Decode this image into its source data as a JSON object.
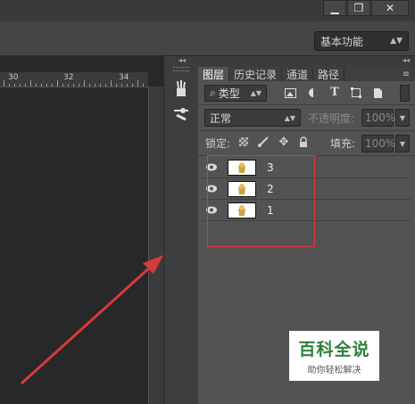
{
  "window": {
    "minimize_label": "▁",
    "restore_label": "❐",
    "close_label": "✕"
  },
  "options_bar": {
    "workspace": "基本功能"
  },
  "ruler": {
    "labels": [
      "30",
      "32",
      "34"
    ]
  },
  "layers_panel": {
    "tabs": [
      "图层",
      "历史记录",
      "通道",
      "路径"
    ],
    "filter_kind": "类型",
    "blend_mode": "正常",
    "opacity_label": "不透明度:",
    "opacity_value": "100%",
    "lock_label": "锁定:",
    "fill_label": "填充:",
    "fill_value": "100%",
    "layers": [
      {
        "name": "3"
      },
      {
        "name": "2"
      },
      {
        "name": "1"
      }
    ]
  },
  "watermark": {
    "title": "百科全说",
    "subtitle": "助你轻松解决"
  },
  "colors": {
    "annotation_red": "#d93a3a",
    "watermark_green": "#2f7f3a"
  }
}
